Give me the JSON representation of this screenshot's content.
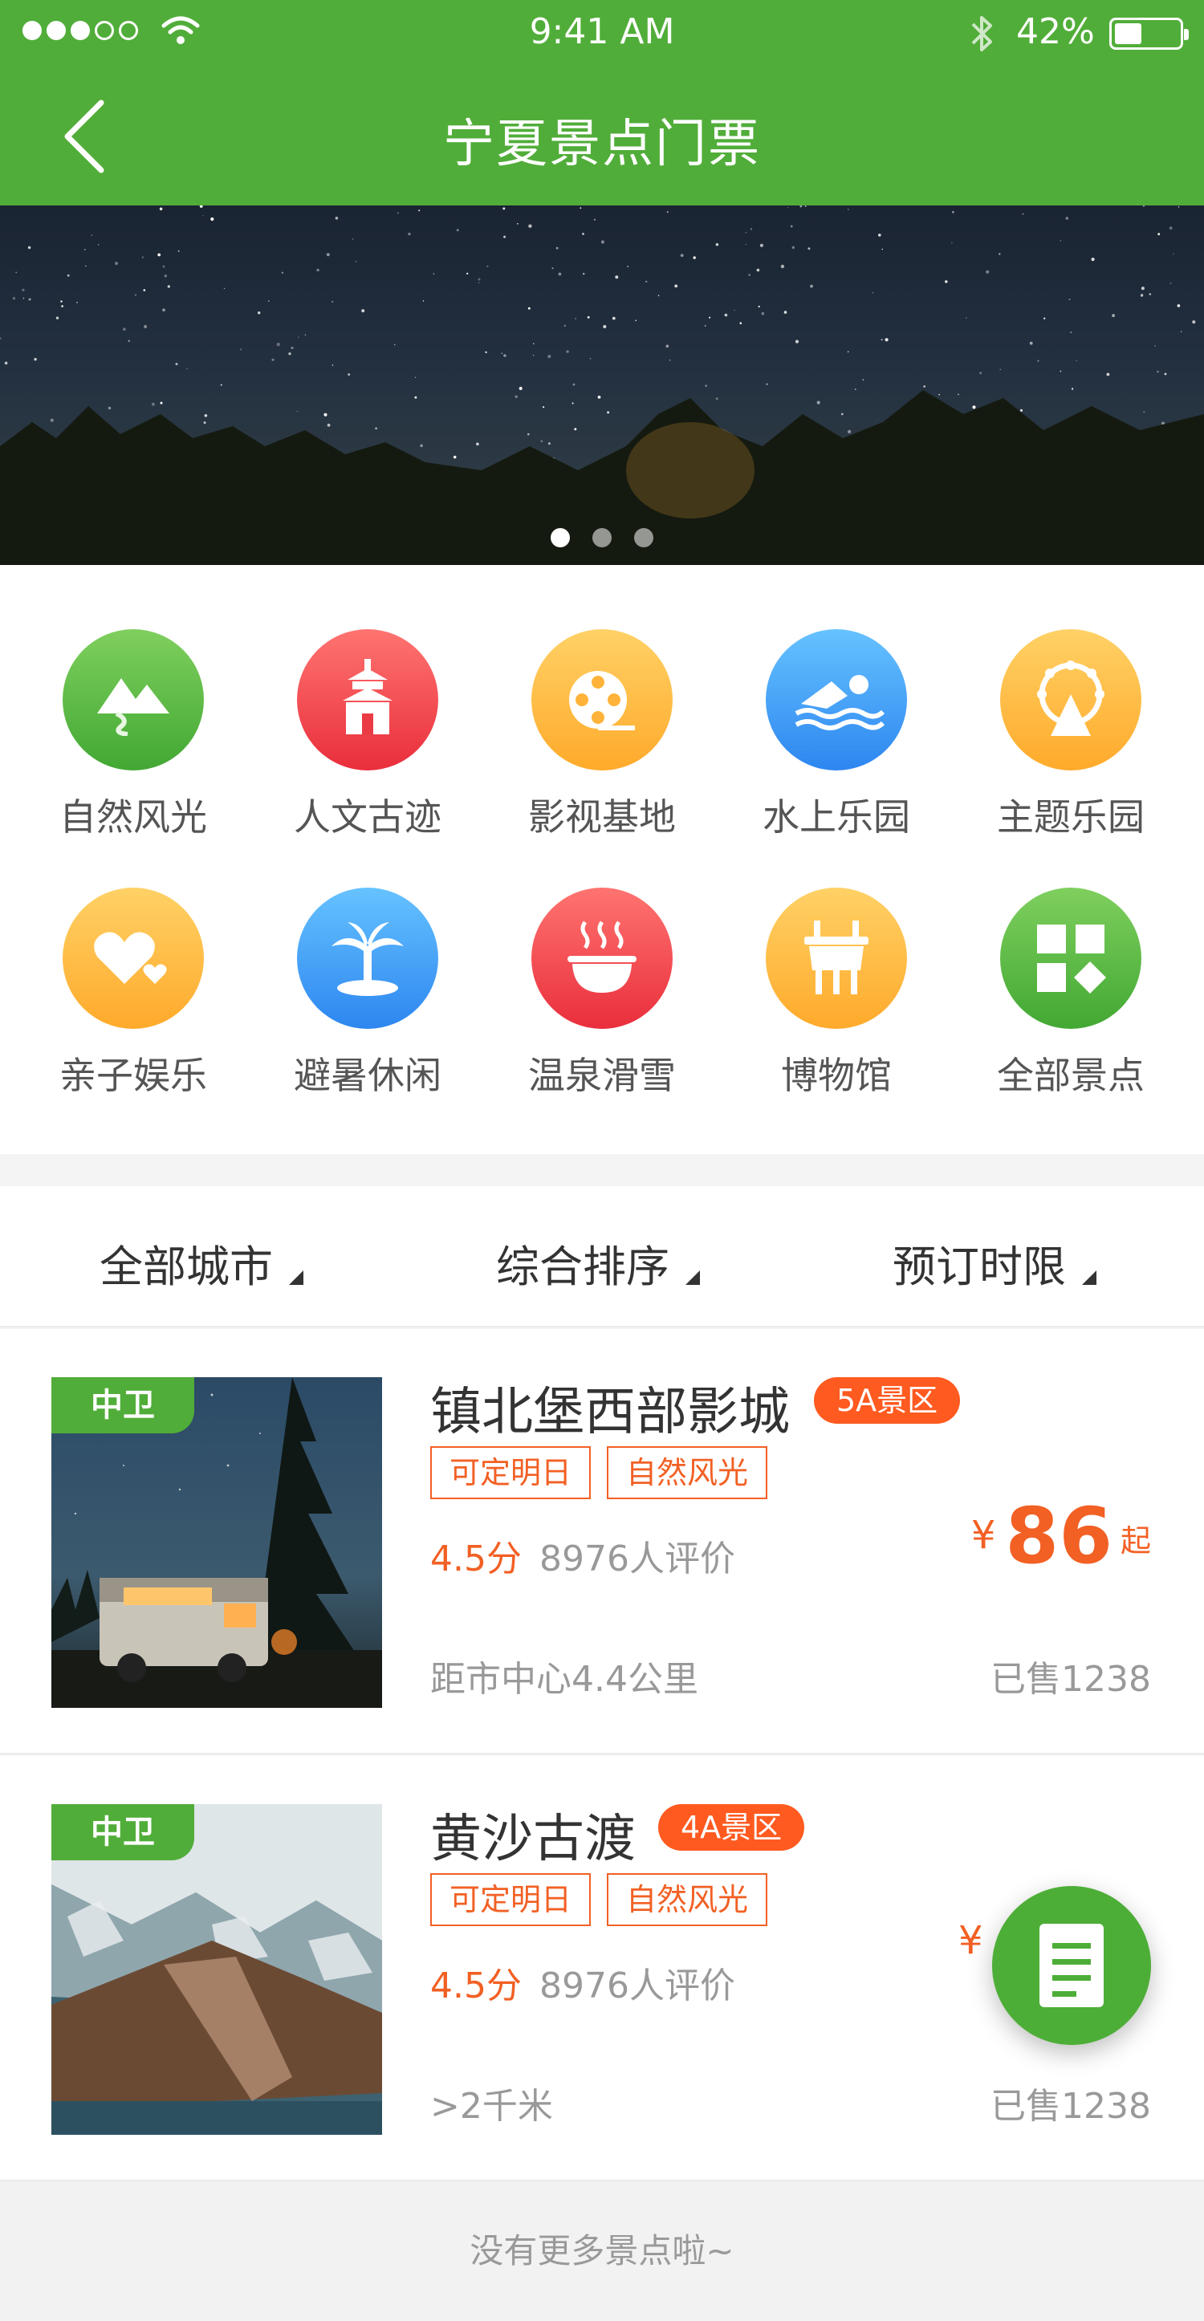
{
  "status_bar": {
    "time": "9:41 AM",
    "battery": "42%",
    "battery_level": 0.42
  },
  "header": {
    "title": "宁夏景点门票"
  },
  "banner": {
    "dots": 3,
    "active_index": 0
  },
  "categories": [
    {
      "label": "自然风光",
      "icon": "mountain-icon",
      "color": "green"
    },
    {
      "label": "人文古迹",
      "icon": "temple-icon",
      "color": "red"
    },
    {
      "label": "影视基地",
      "icon": "film-reel-icon",
      "color": "yellow"
    },
    {
      "label": "水上乐园",
      "icon": "swimmer-icon",
      "color": "blue"
    },
    {
      "label": "主题乐园",
      "icon": "ferris-wheel-icon",
      "color": "yellow"
    },
    {
      "label": "亲子娱乐",
      "icon": "hearts-icon",
      "color": "yellow"
    },
    {
      "label": "避暑休闲",
      "icon": "palm-tree-icon",
      "color": "blue"
    },
    {
      "label": "温泉滑雪",
      "icon": "hot-spring-icon",
      "color": "red"
    },
    {
      "label": "博物馆",
      "icon": "ding-vessel-icon",
      "color": "yellow"
    },
    {
      "label": "全部景点",
      "icon": "grid-icon",
      "color": "green"
    }
  ],
  "filters": [
    {
      "label": "全部城市"
    },
    {
      "label": "综合排序"
    },
    {
      "label": "预订时限"
    }
  ],
  "items": [
    {
      "city": "中卫",
      "name": "镇北堡西部影城",
      "grade": "5A景区",
      "tags": [
        "可定明日",
        "自然风光"
      ],
      "score": "4.5分",
      "reviews": "8976人评价",
      "price_symbol": "¥",
      "price": "86",
      "price_suffix": "起",
      "distance": "距市中心4.4公里",
      "sold": "已售1238"
    },
    {
      "city": "中卫",
      "name": "黄沙古渡",
      "grade": "4A景区",
      "tags": [
        "可定明日",
        "自然风光"
      ],
      "score": "4.5分",
      "reviews": "8976人评价",
      "price_symbol": "¥",
      "distance": ">2千米",
      "sold": "已售1238"
    }
  ],
  "fab": {
    "icon": "document-icon"
  },
  "footer": {
    "text": "没有更多景点啦~"
  },
  "colors": {
    "brand_green": "#51ad39",
    "accent_orange": "#f26024",
    "badge_orange": "#ff5a20"
  }
}
